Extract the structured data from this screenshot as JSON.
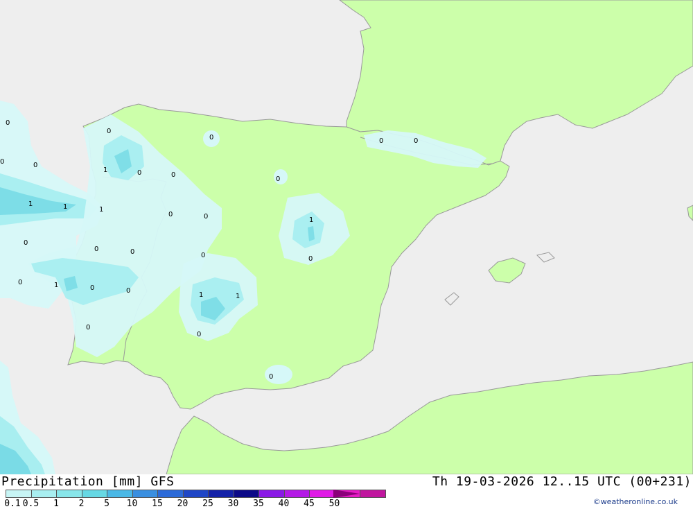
{
  "header": {
    "title": "Precipitation [mm] GFS",
    "datetime": "Th 19-03-2026 12..15 UTC (00+231)"
  },
  "legend": {
    "values": [
      "0.1",
      "0.5",
      "1",
      "2",
      "5",
      "10",
      "15",
      "20",
      "25",
      "30",
      "35",
      "40",
      "45",
      "50"
    ],
    "colors": [
      "#c8f5f5",
      "#a8eef0",
      "#88e6ea",
      "#66d8e4",
      "#4ab8e6",
      "#3a8fe0",
      "#2c6ad8",
      "#1f46c6",
      "#1422a8",
      "#0c0a88",
      "#8a1ae6",
      "#b41ae6",
      "#e01ae6",
      "#e81ac6",
      "#c0169e"
    ],
    "arrow_color": "#8b007a"
  },
  "credit": "©weatheronline.co.uk",
  "map": {
    "colors": {
      "sea": "#eeeeee",
      "land": "#ccffaa",
      "border": "#999999",
      "precip_light": "#d6f8f8",
      "precip_mid": "#a8eef0",
      "precip_strong": "#7adbe6"
    },
    "contour_labels": [
      "0",
      "0",
      "0",
      "0",
      "1",
      "0",
      "0",
      "1",
      "1",
      "1",
      "0",
      "0",
      "0",
      "0",
      "0",
      "1",
      "0",
      "0",
      "0",
      "1",
      "0",
      "0",
      "0",
      "1",
      "1",
      "0",
      "0",
      "0",
      "0",
      "0",
      "0"
    ]
  }
}
